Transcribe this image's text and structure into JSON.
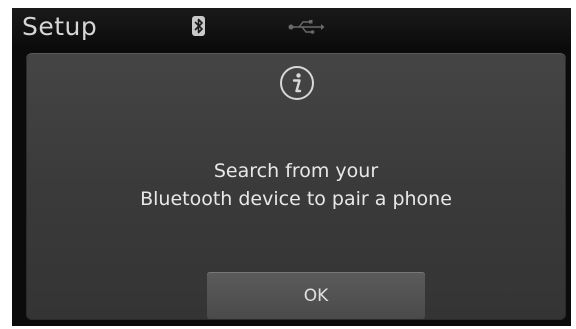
{
  "statusbar": {
    "title": "Setup",
    "icons": [
      "bluetooth-icon",
      "usb-icon"
    ]
  },
  "dialog": {
    "icon": "info-icon",
    "message_line1": "Search from your",
    "message_line2": "Bluetooth device to pair a phone",
    "ok_label": "OK"
  },
  "colors": {
    "screen_bg": "#0b0b0b",
    "dialog_bg": "#3b3b3b",
    "button_bg": "#545454",
    "text": "#e8e8e8"
  }
}
